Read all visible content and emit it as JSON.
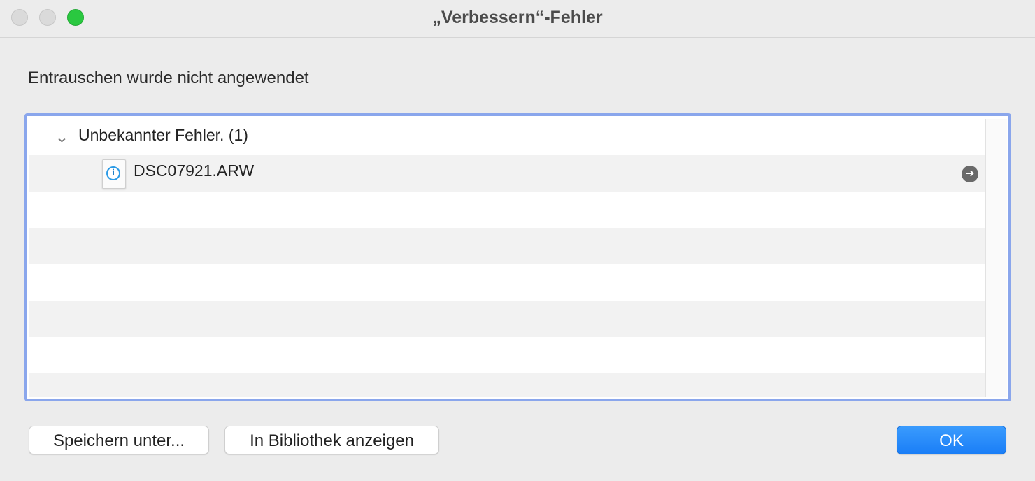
{
  "window": {
    "title": "„Verbessern“-Fehler"
  },
  "message": "Entrauschen wurde nicht angewendet",
  "error_list": {
    "group": {
      "label": "Unbekannter Fehler. (1)",
      "expanded": true
    },
    "items": [
      {
        "label": "DSC07921.ARW",
        "icon": "raw-file-info-icon"
      }
    ]
  },
  "buttons": {
    "save_as": "Speichern unter...",
    "show_in_library": "In Bibliothek anzeigen",
    "ok": "OK"
  },
  "colors": {
    "accent": "#1a7ef7",
    "focus_ring": "#8aa6ec",
    "zoom_button": "#2ac840"
  }
}
